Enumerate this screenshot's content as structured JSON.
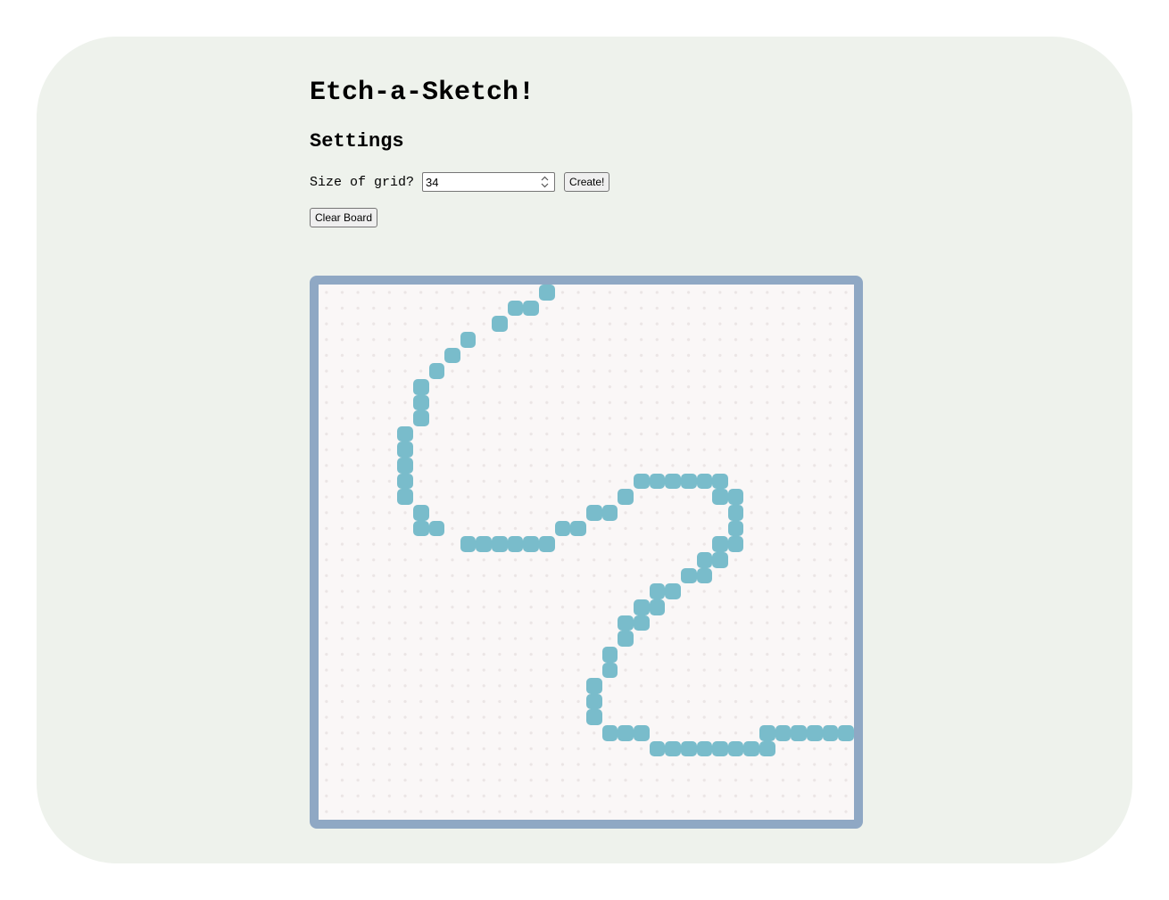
{
  "app": {
    "title": "Etch-a-Sketch!",
    "settings_heading": "Settings"
  },
  "controls": {
    "size_label": "Size of grid?",
    "size_value": "34",
    "create_label": "Create!",
    "clear_label": "Clear Board"
  },
  "board": {
    "grid_size": 34,
    "fill_color": "#79bccb",
    "border_color": "#8fa8c4",
    "background_color": "#faf7f7",
    "painted_cells": [
      [
        14,
        0
      ],
      [
        12,
        1
      ],
      [
        13,
        1
      ],
      [
        11,
        2
      ],
      [
        9,
        3
      ],
      [
        8,
        4
      ],
      [
        7,
        5
      ],
      [
        6,
        6
      ],
      [
        6,
        7
      ],
      [
        6,
        8
      ],
      [
        5,
        9
      ],
      [
        5,
        10
      ],
      [
        5,
        11
      ],
      [
        5,
        12
      ],
      [
        5,
        13
      ],
      [
        6,
        14
      ],
      [
        6,
        15
      ],
      [
        7,
        15
      ],
      [
        9,
        16
      ],
      [
        10,
        16
      ],
      [
        11,
        16
      ],
      [
        12,
        16
      ],
      [
        13,
        16
      ],
      [
        14,
        16
      ],
      [
        15,
        15
      ],
      [
        16,
        15
      ],
      [
        17,
        14
      ],
      [
        18,
        14
      ],
      [
        19,
        13
      ],
      [
        20,
        12
      ],
      [
        21,
        12
      ],
      [
        22,
        12
      ],
      [
        23,
        12
      ],
      [
        24,
        12
      ],
      [
        25,
        12
      ],
      [
        25,
        13
      ],
      [
        26,
        13
      ],
      [
        26,
        14
      ],
      [
        26,
        15
      ],
      [
        25,
        16
      ],
      [
        26,
        16
      ],
      [
        24,
        17
      ],
      [
        25,
        17
      ],
      [
        23,
        18
      ],
      [
        24,
        18
      ],
      [
        21,
        19
      ],
      [
        22,
        19
      ],
      [
        20,
        20
      ],
      [
        21,
        20
      ],
      [
        19,
        21
      ],
      [
        20,
        21
      ],
      [
        19,
        22
      ],
      [
        18,
        23
      ],
      [
        18,
        24
      ],
      [
        17,
        25
      ],
      [
        17,
        26
      ],
      [
        17,
        27
      ],
      [
        18,
        28
      ],
      [
        19,
        28
      ],
      [
        20,
        28
      ],
      [
        21,
        29
      ],
      [
        22,
        29
      ],
      [
        23,
        29
      ],
      [
        24,
        29
      ],
      [
        25,
        29
      ],
      [
        26,
        29
      ],
      [
        27,
        29
      ],
      [
        28,
        29
      ],
      [
        28,
        28
      ],
      [
        29,
        28
      ],
      [
        30,
        28
      ],
      [
        31,
        28
      ],
      [
        32,
        28
      ],
      [
        33,
        28
      ]
    ]
  }
}
